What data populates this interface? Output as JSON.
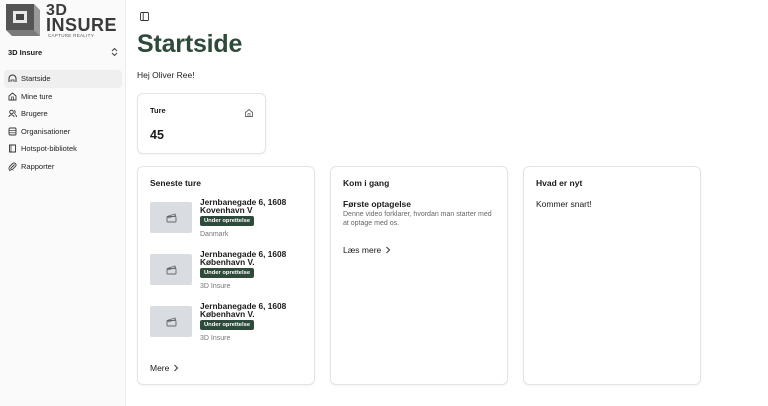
{
  "brand": {
    "logo_line1": "3D",
    "logo_line2": "INSURE",
    "logo_tagline": "CAPTURE REALITY"
  },
  "org": {
    "name": "3D Insure"
  },
  "sidebar": {
    "items": [
      {
        "label": "Startside",
        "icon": "home-icon",
        "active": true
      },
      {
        "label": "Mine ture",
        "icon": "house-icon",
        "active": false
      },
      {
        "label": "Brugere",
        "icon": "users-icon",
        "active": false
      },
      {
        "label": "Organisationer",
        "icon": "building-icon",
        "active": false
      },
      {
        "label": "Hotspot-bibliotek",
        "icon": "book-icon",
        "active": false
      },
      {
        "label": "Rapporter",
        "icon": "clip-icon",
        "active": false
      }
    ]
  },
  "page": {
    "title": "Startside",
    "greeting": "Hej Oliver Ree!"
  },
  "stats": {
    "label": "Ture",
    "value": "45",
    "icon": "home-icon"
  },
  "recent": {
    "heading": "Seneste ture",
    "tours": [
      {
        "title": "Jernbanegade 6, 1608 Kovenhavn V",
        "status": "Under oprettelse",
        "sub": "Danmark"
      },
      {
        "title": "Jernbanegade 6, 1608 København V.",
        "status": "Under oprettelse",
        "sub": "3D Insure"
      },
      {
        "title": "Jernbanegade 6, 1608 København V.",
        "status": "Under oprettelse",
        "sub": "3D Insure"
      }
    ],
    "more_label": "Mere"
  },
  "get_started": {
    "heading": "Kom i gang",
    "subtitle": "Første optagelse",
    "description": "Denne video forklarer, hvordan man starter med at optage med os.",
    "link_label": "Læs mere"
  },
  "news": {
    "heading": "Hvad er nyt",
    "body": "Kommer snart!"
  },
  "colors": {
    "accent": "#2d4a3a",
    "sidebar_bg": "#fafafa",
    "thumb_bg": "#d9dce1"
  }
}
